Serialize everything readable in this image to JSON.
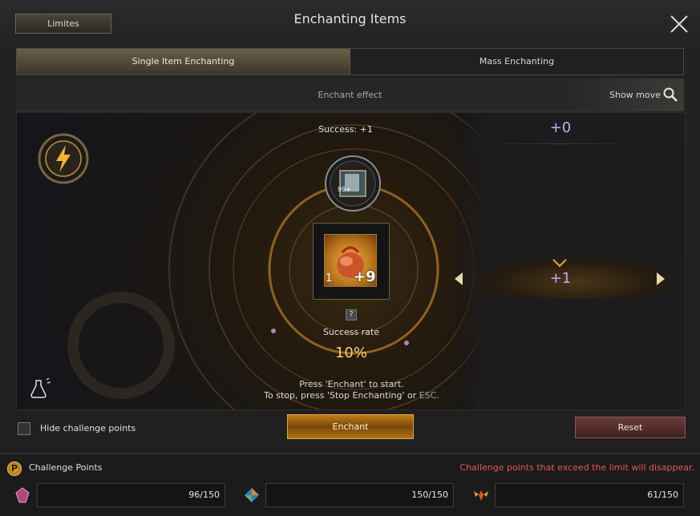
{
  "window": {
    "title": "Enchanting Items",
    "limits_label": "Limites"
  },
  "tabs": [
    {
      "label": "Single Item Enchanting",
      "active": true
    },
    {
      "label": "Mass Enchanting",
      "active": false
    }
  ],
  "effect_bar": {
    "label": "Enchant effect",
    "show_move_label": "Show move"
  },
  "stage": {
    "success_label": "Success: +1",
    "rune_count": "99+",
    "item": {
      "count": "1",
      "plus": "+9"
    },
    "help_glyph": "?",
    "success_rate_label": "Success rate",
    "success_rate_value": "10%",
    "current_level": "+0",
    "next_level": "+1",
    "instruction_line1": "Press 'Enchant' to start.",
    "instruction_line2_prefix": "To stop, press 'Stop Enchanting' or",
    "instruction_line2_key": "ESC."
  },
  "controls": {
    "hide_challenge_label": "Hide challenge points",
    "enchant_label": "Enchant",
    "reset_label": "Reset"
  },
  "challenge": {
    "icon_glyph": "P",
    "label": "Challenge Points",
    "warning": "Challenge points that exceed the limit will disappear.",
    "fields": [
      {
        "value": "96/150",
        "icon": "pink-crystal-icon"
      },
      {
        "value": "150/150",
        "icon": "prism-stone-icon"
      },
      {
        "value": "61/150",
        "icon": "winged-emblem-icon"
      }
    ]
  },
  "colors": {
    "accent_gold": "#f3d27d",
    "level_purple": "#c8a8f8",
    "warning_red": "#e25c4c",
    "enchant_button": "#c07c18"
  }
}
